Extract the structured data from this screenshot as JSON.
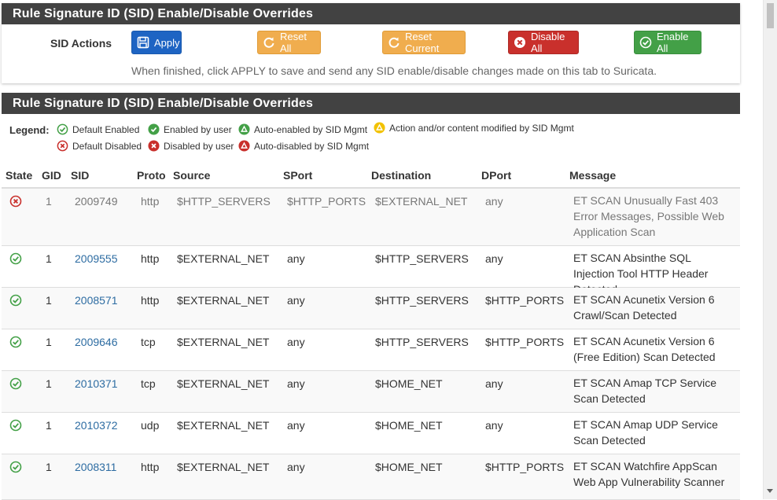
{
  "colors": {
    "heading_bg": "#424242",
    "apply": "#1e64c3",
    "warning": "#f0ad4e",
    "danger": "#c9302c",
    "success": "#43a047",
    "link": "#2d6ca2"
  },
  "actions_panel": {
    "title": "Rule Signature ID (SID) Enable/Disable Overrides",
    "sid_actions_label": "SID Actions",
    "buttons": {
      "apply": "Apply",
      "reset_all": "Reset All",
      "reset_current": "Reset Current",
      "disable_all": "Disable All",
      "enable_all": "Enable All"
    },
    "help_text": "When finished, click APPLY to save and send any SID enable/disable changes made on this tab to Suricata."
  },
  "rules_panel": {
    "title": "Rule Signature ID (SID) Enable/Disable Overrides",
    "legend": {
      "label": "Legend:",
      "items": [
        {
          "text": "Default Enabled",
          "icon": "default-enabled-icon"
        },
        {
          "text": "Enabled by user",
          "icon": "enabled-by-user-icon"
        },
        {
          "text": "Auto-enabled by SID Mgmt",
          "icon": "auto-enabled-icon"
        },
        {
          "text": "Action and/or content modified by SID Mgmt",
          "icon": "modified-icon"
        },
        {
          "text": "Default Disabled",
          "icon": "default-disabled-icon"
        },
        {
          "text": "Disabled by user",
          "icon": "disabled-by-user-icon"
        },
        {
          "text": "Auto-disabled by SID Mgmt",
          "icon": "auto-disabled-icon"
        }
      ]
    },
    "columns": [
      "State",
      "GID",
      "SID",
      "Proto",
      "Source",
      "SPort",
      "Destination",
      "DPort",
      "Message"
    ],
    "rows": [
      {
        "state": "disabled",
        "gid": "1",
        "sid": "2009749",
        "proto": "http",
        "source": "$HTTP_SERVERS",
        "sport": "$HTTP_PORTS",
        "destination": "$EXTERNAL_NET",
        "dport": "any",
        "message": "ET SCAN Unusually Fast 403 Error Messages, Possible Web Application Scan"
      },
      {
        "state": "enabled",
        "gid": "1",
        "sid": "2009555",
        "proto": "http",
        "source": "$EXTERNAL_NET",
        "sport": "any",
        "destination": "$HTTP_SERVERS",
        "dport": "any",
        "message": "ET SCAN Absinthe SQL Injection Tool HTTP Header Detected"
      },
      {
        "state": "enabled",
        "gid": "1",
        "sid": "2008571",
        "proto": "http",
        "source": "$EXTERNAL_NET",
        "sport": "any",
        "destination": "$HTTP_SERVERS",
        "dport": "$HTTP_PORTS",
        "message": "ET SCAN Acunetix Version 6 Crawl/Scan Detected"
      },
      {
        "state": "enabled",
        "gid": "1",
        "sid": "2009646",
        "proto": "tcp",
        "source": "$EXTERNAL_NET",
        "sport": "any",
        "destination": "$HTTP_SERVERS",
        "dport": "$HTTP_PORTS",
        "message": "ET SCAN Acunetix Version 6 (Free Edition) Scan Detected"
      },
      {
        "state": "enabled",
        "gid": "1",
        "sid": "2010371",
        "proto": "tcp",
        "source": "$EXTERNAL_NET",
        "sport": "any",
        "destination": "$HOME_NET",
        "dport": "any",
        "message": "ET SCAN Amap TCP Service Scan Detected"
      },
      {
        "state": "enabled",
        "gid": "1",
        "sid": "2010372",
        "proto": "udp",
        "source": "$EXTERNAL_NET",
        "sport": "any",
        "destination": "$HOME_NET",
        "dport": "any",
        "message": "ET SCAN Amap UDP Service Scan Detected"
      },
      {
        "state": "enabled",
        "gid": "1",
        "sid": "2008311",
        "proto": "http",
        "source": "$EXTERNAL_NET",
        "sport": "any",
        "destination": "$HOME_NET",
        "dport": "$HTTP_PORTS",
        "message": "ET SCAN Watchfire AppScan Web App Vulnerability Scanner"
      }
    ]
  }
}
